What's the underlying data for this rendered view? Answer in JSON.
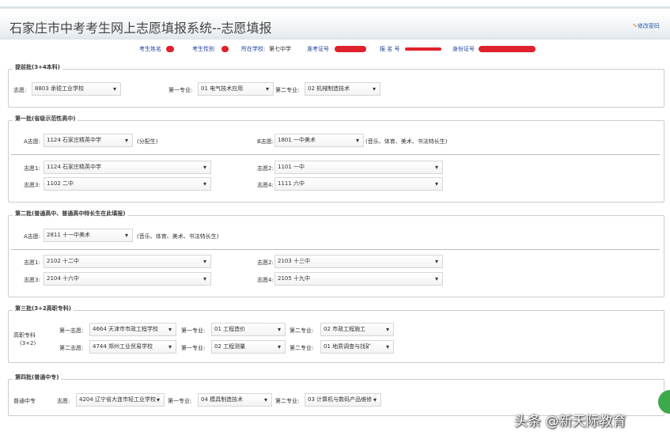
{
  "header": {
    "title": "石家庄市中考考生网上志愿填报系统--志愿填报",
    "change_password": "修改密码"
  },
  "info": {
    "name_label": "考生姓名",
    "gender_label": "考生性别",
    "school_label": "所在学校:",
    "school_value": "第七中学",
    "ticket_label": "准考证号",
    "reg_label": "报 名 号",
    "id_label": "身份证号"
  },
  "s1": {
    "legend": "提前批(3+4本科)",
    "l_wish": "志愿:",
    "wish": "8803 承德工业学校",
    "l_m1": "第一专业:",
    "m1": "01 电气技术应用",
    "l_m2": "第二专业:",
    "m2": "02 机械制造技术"
  },
  "s2": {
    "legend": "第一批(省级示范性高中)",
    "a_label": "A志愿:",
    "a": "1124 石家庄精英中学",
    "a_note": "(分配生)",
    "b_label": "B志愿:",
    "b": "1801 一中美术",
    "b_note": "(音乐、体育、美术、书法特长生)",
    "w1_label": "志愿1:",
    "w1": "1124 石家庄精英中学",
    "w2_label": "志愿2:",
    "w2": "1101 一中",
    "w3_label": "志愿3:",
    "w3": "1102 二中",
    "w4_label": "志愿4:",
    "w4": "1111 六中"
  },
  "s3": {
    "legend": "第二批(普通高中、普通高中特长生在此填报)",
    "a_label": "A志愿:",
    "a": "2811 十一中美术",
    "a_note": "(音乐、体育、美术、书法特长生)",
    "w1_label": "志愿1:",
    "w1": "2102 十二中",
    "w2_label": "志愿2:",
    "w2": "2103 十三中",
    "w3_label": "志愿3:",
    "w3": "2104 十六中",
    "w4_label": "志愿4:",
    "w4": "2105 十九中"
  },
  "s4": {
    "legend": "第三批(3+2高职专科)",
    "side1": "高职专科",
    "side2": "(3+2)",
    "r1": {
      "l_wish": "第一志愿:",
      "wish": "4664 天津市市政工程学校",
      "l_m1": "第一专业:",
      "m1": "01 工程造价",
      "l_m2": "第二专业:",
      "m2": "02 市政工程施工"
    },
    "r2": {
      "l_wish": "第二志愿:",
      "wish": "4744 郑州工业贸易学校",
      "l_m1": "第一专业:",
      "m1": "02 工程测量",
      "l_m2": "第二专业:",
      "m2": "01 地质调查与找矿"
    }
  },
  "s5": {
    "legend": "第四批(普通中专)",
    "side": "普通中专",
    "l_wish": "志愿:",
    "wish": "4204 辽宁省大连市轻工业学校",
    "l_m1": "第一专业:",
    "m1": "04 模具制造技术",
    "l_m2": "第二专业:",
    "m2": "03 计算机与数码产品维修"
  },
  "watermark": "头条 @新天际教育"
}
